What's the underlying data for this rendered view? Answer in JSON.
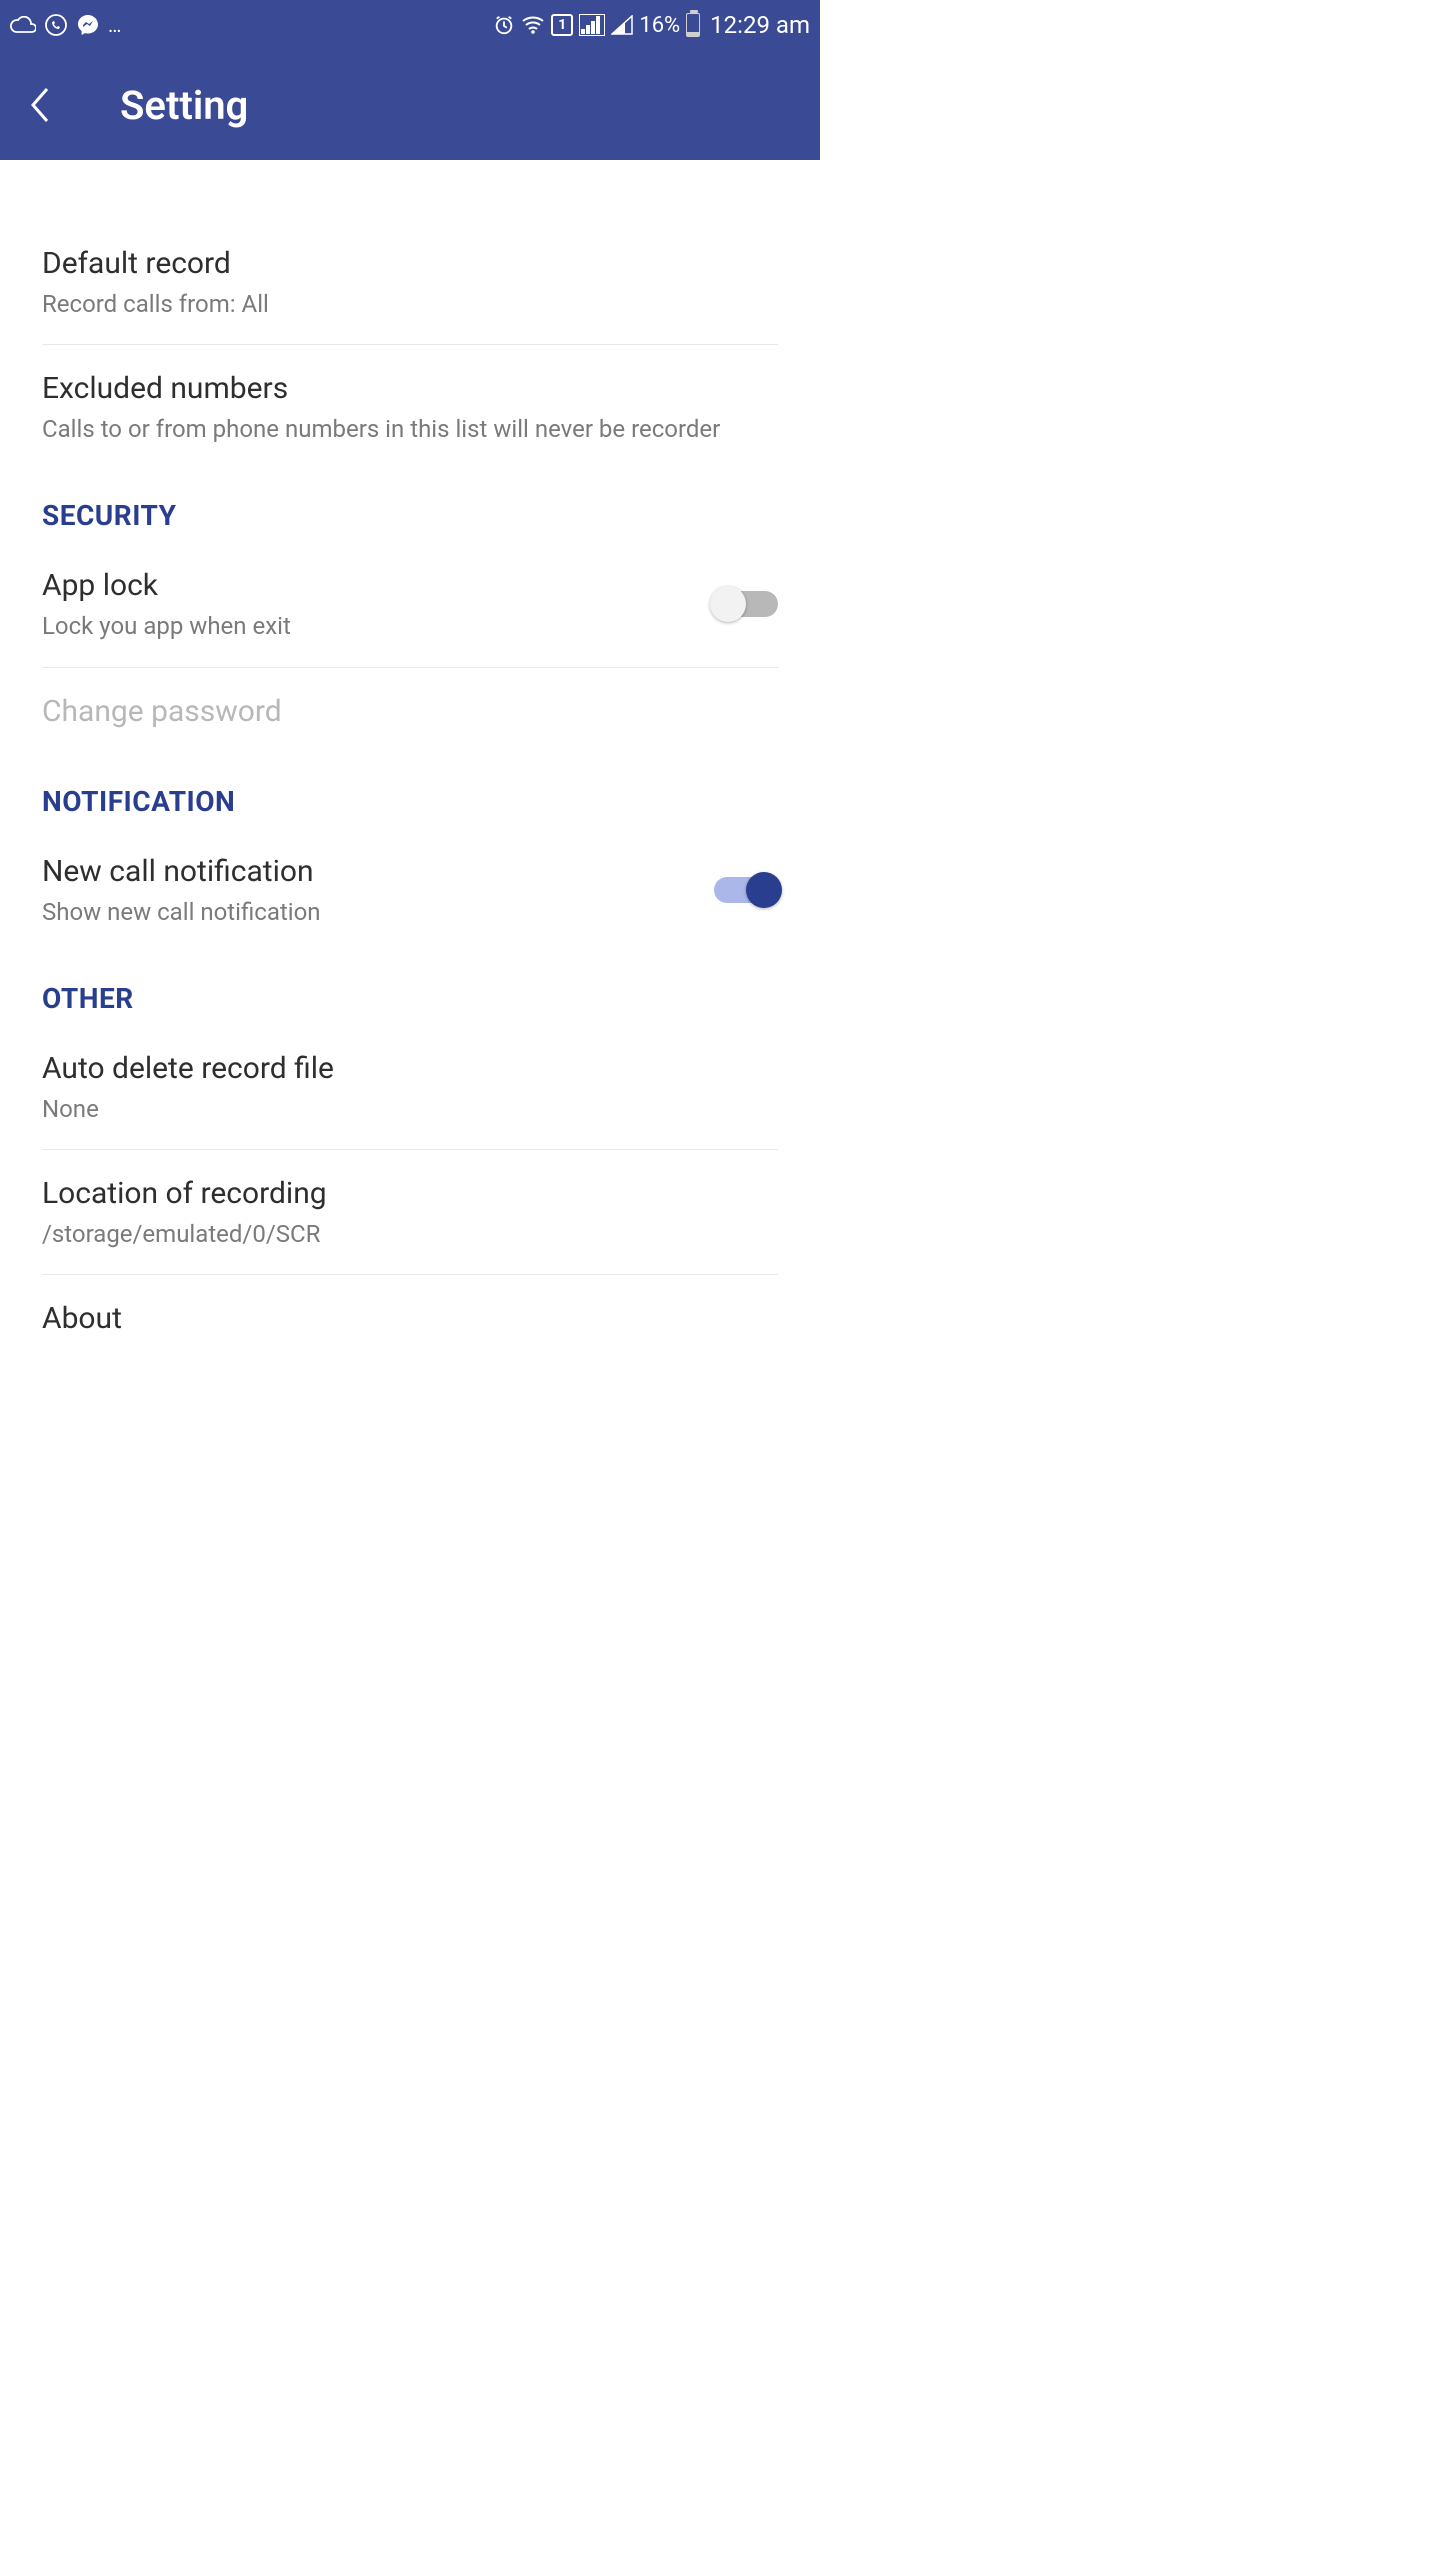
{
  "status": {
    "battery_pct": "16%",
    "time": "12:29 am",
    "sim_label": "1"
  },
  "appbar": {
    "title": "Setting"
  },
  "items": {
    "default_record": {
      "title": "Default record",
      "sub": "Record calls from: All"
    },
    "excluded_numbers": {
      "title": "Excluded numbers",
      "sub": "Calls to or from phone numbers in this list will never be recorder"
    },
    "app_lock": {
      "title": "App lock",
      "sub": "Lock you app when exit"
    },
    "change_password": {
      "title": "Change password"
    },
    "new_call_notification": {
      "title": "New call notification",
      "sub": "Show new call notification"
    },
    "auto_delete": {
      "title": "Auto delete record file",
      "sub": "None"
    },
    "location_recording": {
      "title": "Location of recording",
      "sub": "/storage/emulated/0/SCR"
    },
    "about": {
      "title": "About"
    }
  },
  "sections": {
    "security": "SECURITY",
    "notification": "NOTIFICATION",
    "other": "OTHER"
  }
}
